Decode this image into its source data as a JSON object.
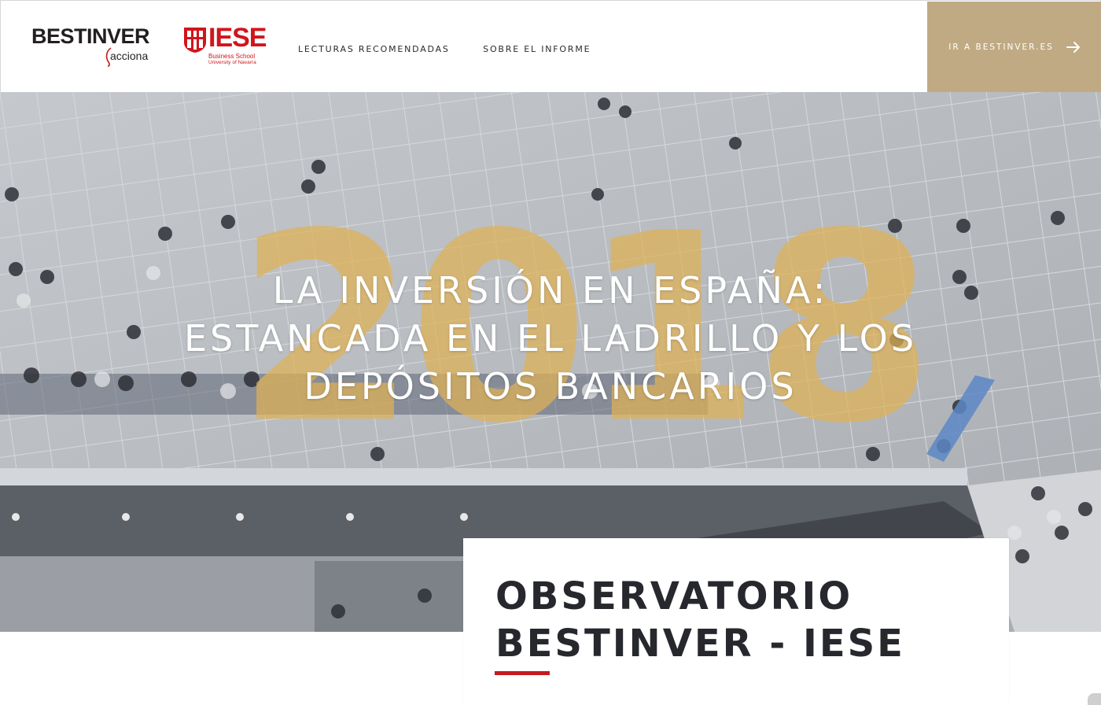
{
  "header": {
    "brand_bestinver": "BESTINVER",
    "brand_bestinver_sub": "acciona",
    "brand_iese": "IESE",
    "brand_iese_sub1": "Business School",
    "brand_iese_sub2": "University of Navarra",
    "nav": [
      {
        "label": "LECTURAS RECOMENDADAS"
      },
      {
        "label": "SOBRE EL INFORME"
      }
    ],
    "cta_label": "IR A BESTINVER.ES"
  },
  "hero": {
    "year": "2018",
    "title_lines": [
      "LA INVERSIÓN EN ESPAÑA:",
      "ESTANCADA EN EL LADRILLO Y LOS",
      "DEPÓSITOS BANCARIOS"
    ]
  },
  "card": {
    "title_lines": [
      "OBSERVATORIO",
      "BESTINVER - IESE"
    ]
  },
  "colors": {
    "accent_gold": "#c0aa83",
    "year_gold": "#e0b255",
    "accent_red": "#c41a1f",
    "iese_red": "#d1151c"
  }
}
